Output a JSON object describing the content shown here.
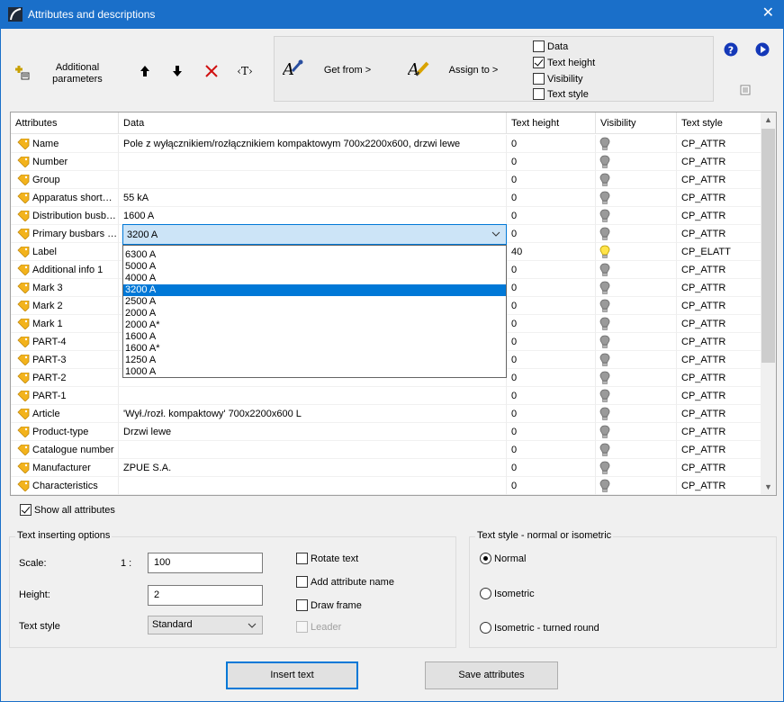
{
  "window": {
    "title": "Attributes and descriptions",
    "close_glyph": "✕"
  },
  "toolbar": {
    "additional_parameters_label": "Additional parameters",
    "move_up_glyph": "🡅",
    "move_down_glyph": "🡇",
    "delete_glyph": "✕",
    "text_tag_glyph": "‹T›",
    "get_from_label": "Get from >",
    "assign_to_label": "Assign to >"
  },
  "assign_options": [
    {
      "label": "Data",
      "checked": false
    },
    {
      "label": "Text height",
      "checked": true
    },
    {
      "label": "Visibility",
      "checked": false
    },
    {
      "label": "Text style",
      "checked": false
    }
  ],
  "grid": {
    "columns": [
      "Attributes",
      "Data",
      "Text height",
      "Visibility",
      "Text style"
    ],
    "rows": [
      {
        "attr": "Name",
        "data": "Pole z wyłącznikiem/rozłącznikiem kompaktowym 700x2200x600, drzwi lewe",
        "height": "0",
        "visible": false,
        "style": "CP_ATTR"
      },
      {
        "attr": "Number",
        "data": "",
        "height": "0",
        "visible": false,
        "style": "CP_ATTR"
      },
      {
        "attr": "Group",
        "data": "",
        "height": "0",
        "visible": false,
        "style": "CP_ATTR"
      },
      {
        "attr": "Apparatus short…",
        "data": "55 kA",
        "height": "0",
        "visible": false,
        "style": "CP_ATTR"
      },
      {
        "attr": "Distribution busb…",
        "data": "1600 A",
        "height": "0",
        "visible": false,
        "style": "CP_ATTR"
      },
      {
        "attr": "Primary busbars …",
        "data": "",
        "height": "0",
        "visible": false,
        "style": "CP_ATTR"
      },
      {
        "attr": "Label",
        "data": "",
        "height": "40",
        "visible": true,
        "style": "CP_ELATT"
      },
      {
        "attr": "Additional info 1",
        "data": "",
        "height": "0",
        "visible": false,
        "style": "CP_ATTR"
      },
      {
        "attr": "Mark 3",
        "data": "",
        "height": "0",
        "visible": false,
        "style": "CP_ATTR"
      },
      {
        "attr": "Mark 2",
        "data": "",
        "height": "0",
        "visible": false,
        "style": "CP_ATTR"
      },
      {
        "attr": "Mark 1",
        "data": "",
        "height": "0",
        "visible": false,
        "style": "CP_ATTR"
      },
      {
        "attr": "PART-4",
        "data": "",
        "height": "0",
        "visible": false,
        "style": "CP_ATTR"
      },
      {
        "attr": "PART-3",
        "data": "",
        "height": "0",
        "visible": false,
        "style": "CP_ATTR"
      },
      {
        "attr": "PART-2",
        "data": "",
        "height": "0",
        "visible": false,
        "style": "CP_ATTR"
      },
      {
        "attr": "PART-1",
        "data": "",
        "height": "0",
        "visible": false,
        "style": "CP_ATTR"
      },
      {
        "attr": "Article",
        "data": "'Wył./rozł. kompaktowy'  700x2200x600 L",
        "height": "0",
        "visible": false,
        "style": "CP_ATTR"
      },
      {
        "attr": "Product-type",
        "data": "Drzwi lewe",
        "height": "0",
        "visible": false,
        "style": "CP_ATTR"
      },
      {
        "attr": "Catalogue number",
        "data": "",
        "height": "0",
        "visible": false,
        "style": "CP_ATTR"
      },
      {
        "attr": "Manufacturer",
        "data": "ZPUE S.A.",
        "height": "0",
        "visible": false,
        "style": "CP_ATTR"
      },
      {
        "attr": "Characteristics",
        "data": "",
        "height": "0",
        "visible": false,
        "style": "CP_ATTR"
      }
    ]
  },
  "combo": {
    "value": "3200 A",
    "options": [
      "6300 A",
      "5000 A",
      "4000 A",
      "3200 A",
      "2500 A",
      "2000 A",
      "2000 A*",
      "1600 A",
      "1600 A*",
      "1250 A",
      "1000 A"
    ],
    "selected": "3200 A"
  },
  "show_all": {
    "label": "Show all attributes",
    "checked": true
  },
  "text_options": {
    "legend": "Text inserting options",
    "scale_label": "Scale:",
    "scale_prefix": "1 :",
    "scale_value": "100",
    "height_label": "Height:",
    "height_value": "2",
    "style_label": "Text style",
    "style_value": "Standard",
    "rotate_label": "Rotate text",
    "add_name_label": "Add attribute name",
    "draw_frame_label": "Draw frame",
    "leader_label": "Leader"
  },
  "text_style": {
    "legend": "Text style - normal or isometric",
    "options": [
      {
        "label": "Normal",
        "selected": true
      },
      {
        "label": "Isometric",
        "selected": false
      },
      {
        "label": "Isometric - turned round",
        "selected": false
      }
    ]
  },
  "buttons": {
    "insert": "Insert text",
    "save": "Save attributes"
  },
  "colors": {
    "titlebar": "#1a6fc9",
    "accent": "#0078d7",
    "delete": "#d01010",
    "bulb_on": "#ffe44a"
  }
}
